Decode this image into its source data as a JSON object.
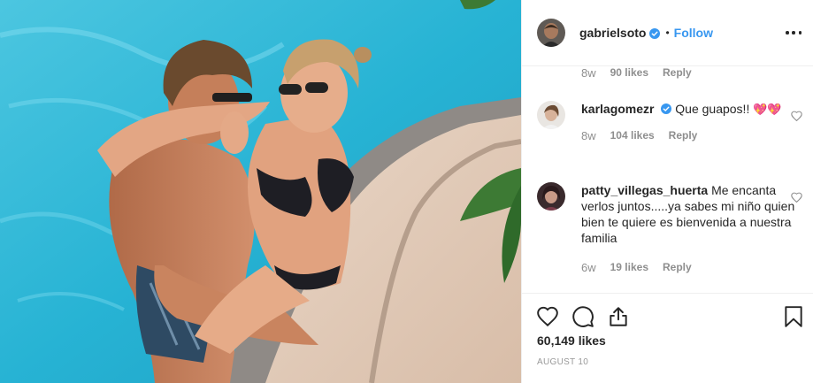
{
  "post": {
    "author": "gabrielsoto",
    "follow_label": "Follow",
    "separator": "•"
  },
  "comments": {
    "first_meta": {
      "time": "8w",
      "likes": "90 likes",
      "reply": "Reply"
    },
    "items": [
      {
        "username": "karlagomezr",
        "text": "Que guapos!!",
        "emoji": "💖💖",
        "time": "8w",
        "likes": "104 likes",
        "reply": "Reply"
      },
      {
        "username": "patty_villegas_huerta",
        "text": "Me encanta verlos juntos.....ya sabes mi niño quien bien te quiere es bienvenida a nuestra familia",
        "time": "6w",
        "likes": "19 likes",
        "reply": "Reply"
      }
    ]
  },
  "footer": {
    "likes": "60,149 likes",
    "date": "AUGUST 10"
  },
  "icons": {
    "verified": "verified-badge-icon",
    "more": "more-options-icon",
    "like": "heart-icon",
    "comment": "comment-bubble-icon",
    "share": "share-icon",
    "save": "bookmark-icon"
  },
  "colors": {
    "link": "#3897f0",
    "muted": "#8e8e8e",
    "text": "#262626",
    "pool": "#2ab7d6"
  }
}
